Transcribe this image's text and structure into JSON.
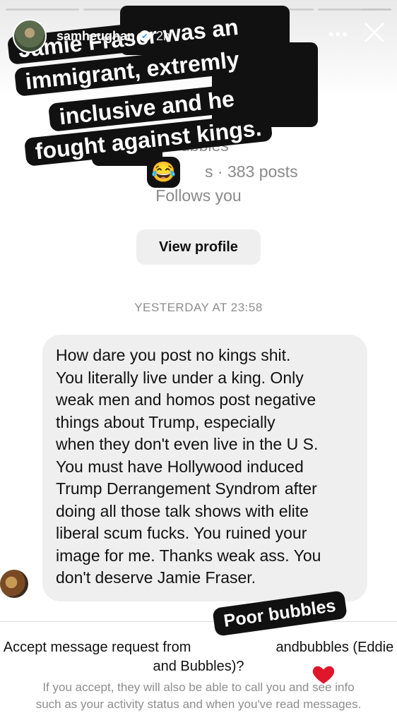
{
  "story": {
    "segments_fill": [
      1,
      1,
      1,
      1,
      0.6
    ],
    "username": "samheughan",
    "time_ago": "2h",
    "more_label": "•••",
    "caption_lines": [
      "Jamie Fraser was an",
      "immigrant, extremly",
      "inclusive and he",
      "fought against kings."
    ],
    "emoji": "😂",
    "sticker_text": "Poor bubbles"
  },
  "profile": {
    "stats_partial": "s · 383 posts",
    "follows_you": "Follows you",
    "handle_partial": "ubbles",
    "view_profile_label": "View profile"
  },
  "conversation": {
    "timestamp": "YESTERDAY AT 23:58",
    "message_lines": [
      "How dare you post no kings shit.",
      "You literally live under a king. Only",
      "weak men and homos post negative",
      "things about Trump, especially",
      "when they don't even live in the U S.",
      "You must have Hollywood induced",
      "Trump Derrangement Syndrom after",
      "doing all those talk shows with elite",
      "liberal scum fucks. You ruined your",
      "image for me. Thanks weak ass. You",
      "don't deserve Jamie Fraser."
    ]
  },
  "request": {
    "line1_start": "Accept message request from",
    "line1_end": "andbubbles (Eddie",
    "line2": "and Bubbles)?",
    "info_line1": "If you accept, they will also be able to call you and see info",
    "info_line2": "such as your activity status and when you've read messages."
  },
  "colors": {
    "caption_bg": "#111111",
    "bubble_bg": "#efefef",
    "heart": "#e0162b",
    "muted": "#8e8e8e"
  }
}
